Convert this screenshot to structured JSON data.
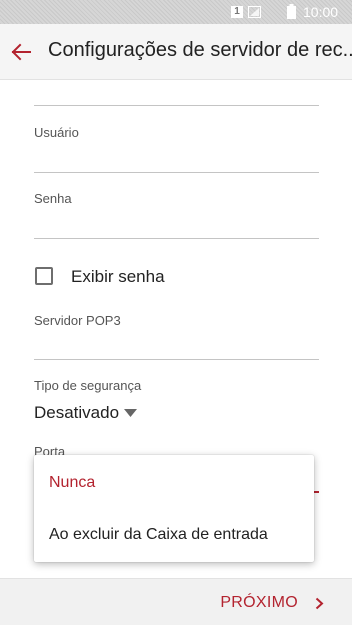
{
  "status_bar": {
    "sim_slot": "1",
    "time": "10:00"
  },
  "header": {
    "title": "Configurações de servidor de rec..."
  },
  "form": {
    "username_label": "Usuário",
    "username_value": "",
    "password_label": "Senha",
    "password_value": "",
    "show_password_label": "Exibir senha",
    "show_password_checked": false,
    "pop3_server_label": "Servidor POP3",
    "pop3_server_value": "",
    "security_type_label": "Tipo de segurança",
    "security_type_value": "Desativado",
    "port_label": "Porta"
  },
  "delete_menu": {
    "options": [
      {
        "label": "Nunca",
        "selected": true
      },
      {
        "label": "Ao excluir da Caixa de entrada",
        "selected": false
      }
    ]
  },
  "footer": {
    "next_label": "PRÓXIMO"
  },
  "colors": {
    "accent": "#b3232f",
    "app_bar": "#f5f5f5",
    "divider": "#c4c4c4"
  }
}
